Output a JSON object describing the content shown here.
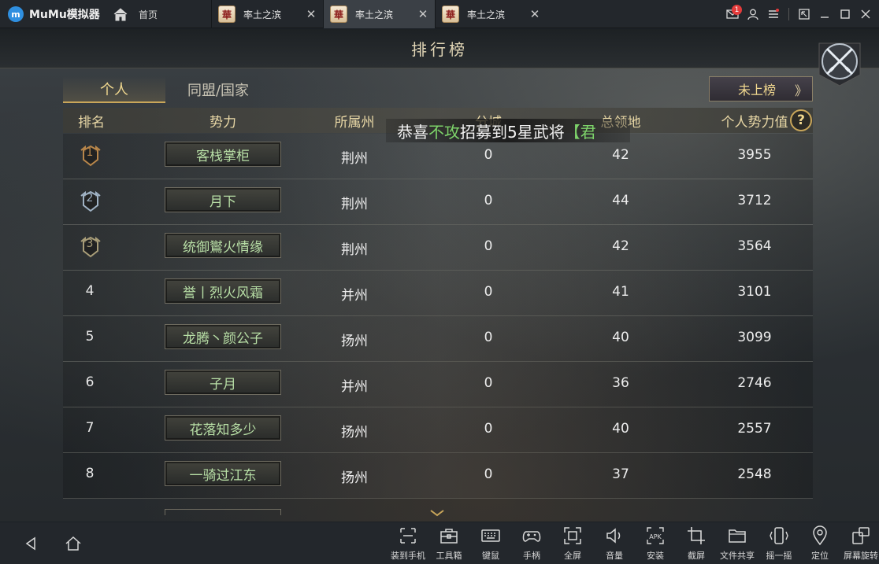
{
  "titlebar": {
    "brand": "MuMu模拟器",
    "home_label": "首页",
    "tabs": [
      {
        "icon_char": "華",
        "label": "率土之滨",
        "active": false
      },
      {
        "icon_char": "華",
        "label": "率土之滨",
        "active": true
      },
      {
        "icon_char": "華",
        "label": "率土之滨",
        "active": false
      }
    ],
    "mail_badge": "1"
  },
  "game": {
    "title": "排行榜",
    "tabs": [
      "个人",
      "同盟/国家"
    ],
    "unranked_label": "未上榜",
    "unranked_arrow": "》",
    "columns": [
      "排名",
      "势力",
      "所属州",
      "分城",
      "总领地",
      "个人势力值"
    ],
    "help": "?",
    "toast": {
      "prefix": "恭喜",
      "player": "不攻",
      "middle": "招募到5星武将",
      "suffix": "【君"
    },
    "rows": [
      {
        "rank": "1",
        "name": "客栈掌柜",
        "state": "荆州",
        "branch": "0",
        "territory": "42",
        "power": "3955"
      },
      {
        "rank": "2",
        "name": "月下",
        "state": "荆州",
        "branch": "0",
        "territory": "44",
        "power": "3712"
      },
      {
        "rank": "3",
        "name": "统御鸑火情缘",
        "state": "荆州",
        "branch": "0",
        "territory": "42",
        "power": "3564"
      },
      {
        "rank": "4",
        "name": "誉丨烈火风霜",
        "state": "并州",
        "branch": "0",
        "territory": "41",
        "power": "3101"
      },
      {
        "rank": "5",
        "name": "龙腾丶颜公子",
        "state": "扬州",
        "branch": "0",
        "territory": "40",
        "power": "3099"
      },
      {
        "rank": "6",
        "name": "子月",
        "state": "并州",
        "branch": "0",
        "territory": "36",
        "power": "2746"
      },
      {
        "rank": "7",
        "name": "花落知多少",
        "state": "扬州",
        "branch": "0",
        "territory": "40",
        "power": "2557"
      },
      {
        "rank": "8",
        "name": "一骑过江东",
        "state": "扬州",
        "branch": "0",
        "territory": "37",
        "power": "2548"
      }
    ]
  },
  "toolbar": {
    "tools": [
      {
        "label": "装到手机",
        "icon": "install-to-phone-icon"
      },
      {
        "label": "工具箱",
        "icon": "toolbox-icon"
      },
      {
        "label": "键鼠",
        "icon": "keyboard-icon"
      },
      {
        "label": "手柄",
        "icon": "gamepad-icon"
      },
      {
        "label": "全屏",
        "icon": "fullscreen-icon"
      },
      {
        "label": "音量",
        "icon": "volume-icon"
      },
      {
        "label": "安装",
        "icon": "apk-install-icon"
      },
      {
        "label": "截屏",
        "icon": "crop-icon"
      },
      {
        "label": "文件共享",
        "icon": "folder-icon"
      },
      {
        "label": "摇一摇",
        "icon": "shake-icon"
      },
      {
        "label": "定位",
        "icon": "location-icon"
      },
      {
        "label": "屏幕旋转",
        "icon": "rotate-screen-icon"
      }
    ]
  }
}
